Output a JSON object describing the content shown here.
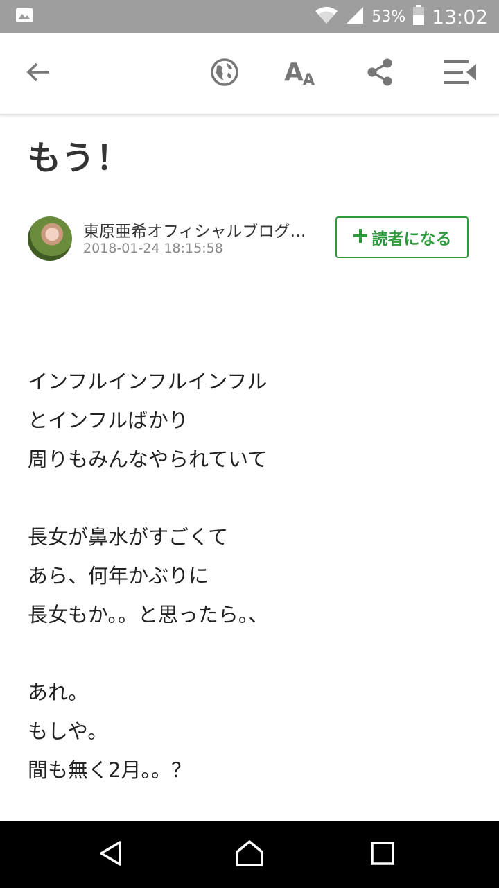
{
  "status_bar": {
    "battery_percent": "53%",
    "time": "13:02",
    "icons": [
      "image-icon",
      "wifi-icon",
      "signal-icon",
      "battery-icon"
    ]
  },
  "toolbar": {
    "icons": [
      "back-arrow-icon",
      "globe-icon",
      "font-size-icon",
      "share-icon",
      "playlist-menu-icon"
    ]
  },
  "post": {
    "title": "もう！",
    "author": "東原亜希オフィシャルブログ…",
    "datetime": "2018-01-24 18:15:58",
    "follow_label": "読者になる",
    "follow_icon": "plus-icon",
    "paragraphs": [
      [
        "インフルインフルインフル",
        "とインフルばかり",
        "周りもみんなやられていて"
      ],
      [
        "長女が鼻水がすごくて",
        "あら、何年かぶりに",
        "長女もか。。と思ったら。、"
      ],
      [
        "あれ。",
        "もしや。",
        "間も無く2月。。？"
      ]
    ]
  },
  "colors": {
    "status_bar": "#9e9e9e",
    "accent_green": "#2e9a3e",
    "nav_bar": "#000000"
  },
  "nav_bar": {
    "icons": [
      "nav-back-icon",
      "nav-home-icon",
      "nav-recents-icon"
    ]
  }
}
